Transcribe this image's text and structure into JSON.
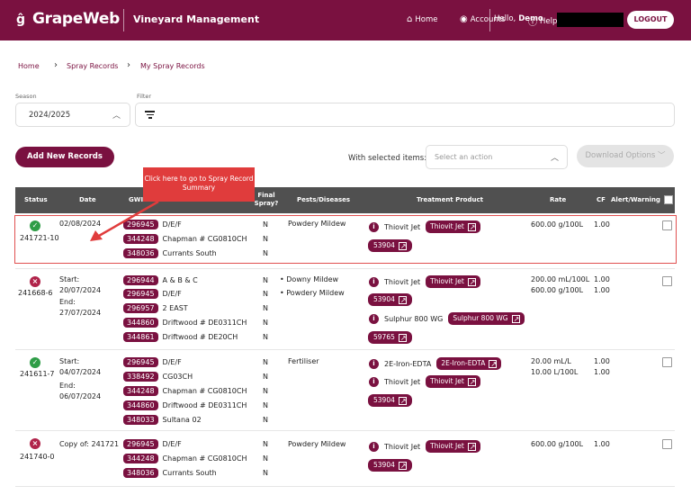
{
  "header": {
    "brand": "GrapeWeb",
    "app_title": "Vineyard Management",
    "nav": {
      "home": "Home",
      "accounts": "Accounts",
      "help": "Help"
    },
    "greeting_prefix": "Hello, ",
    "user_name": "Demo",
    "logout": "LOGOUT"
  },
  "breadcrumb": {
    "items": [
      "Home",
      "Spray Records",
      "My Spray Records"
    ]
  },
  "filters": {
    "season_label": "Season",
    "season_value": "2024/2025",
    "filter_label": "Filter"
  },
  "actions": {
    "add_label": "Add New Records",
    "with_selected": "With selected items:",
    "select_placeholder": "Select an action",
    "download": "Download Options"
  },
  "tooltip": {
    "text": "Click here to go to Spray Record Summary"
  },
  "table": {
    "headers": {
      "status": "Status",
      "date": "Date",
      "gwi": "GWI",
      "final_spray": "Final Spray?",
      "pests": "Pests/Diseases",
      "product": "Treatment Product",
      "rate": "Rate",
      "cf": "CF",
      "alert": "Alert/Warning"
    },
    "rows": [
      {
        "status": "ok",
        "id": "241721-10",
        "date_lines": [
          "02/08/2024"
        ],
        "gwi": [
          {
            "code": "296945",
            "name": "D/E/F",
            "final": "N"
          },
          {
            "code": "344248",
            "name": "Chapman # CG0810CH",
            "final": "N"
          },
          {
            "code": "348036",
            "name": "Currants South",
            "final": "N"
          }
        ],
        "pests": [
          "Powdery Mildew"
        ],
        "products": [
          {
            "name": "Thiovit Jet",
            "pill": "Thiovit Jet"
          }
        ],
        "codes": [
          "53904"
        ],
        "rates": [
          "600.00 g/100L"
        ],
        "cf": [
          "1.00"
        ]
      },
      {
        "status": "x",
        "id": "241668-6",
        "date_lines": [
          "Start:",
          "20/07/2024",
          "End:",
          "27/07/2024"
        ],
        "gwi": [
          {
            "code": "296944",
            "name": "A & B & C",
            "final": "N"
          },
          {
            "code": "296945",
            "name": "D/E/F",
            "final": "N"
          },
          {
            "code": "296957",
            "name": "2 EAST",
            "final": "N"
          },
          {
            "code": "344860",
            "name": "Driftwood # DE0311CH",
            "final": "N"
          },
          {
            "code": "344861",
            "name": "Driftwood # DE20CH",
            "final": "N"
          }
        ],
        "pests": [
          "Downy Mildew",
          "Powdery Mildew"
        ],
        "products": [
          {
            "name": "Thiovit Jet",
            "pill": "Thiovit Jet"
          },
          {
            "name": "Sulphur 800 WG",
            "pill": "Sulphur 800 WG"
          }
        ],
        "codes": [
          "53904",
          "59765"
        ],
        "rates": [
          "200.00 mL/100L",
          "600.00 g/100L"
        ],
        "cf": [
          "1.00",
          "1.00"
        ]
      },
      {
        "status": "ok",
        "id": "241611-7",
        "date_lines": [
          "Start:",
          "04/07/2024",
          "End:",
          "06/07/2024"
        ],
        "gwi": [
          {
            "code": "296945",
            "name": "D/E/F",
            "final": "N"
          },
          {
            "code": "338492",
            "name": "CG03CH",
            "final": "N"
          },
          {
            "code": "344248",
            "name": "Chapman # CG0810CH",
            "final": "N"
          },
          {
            "code": "344860",
            "name": "Driftwood # DE0311CH",
            "final": "N"
          },
          {
            "code": "348033",
            "name": "Sultana 02",
            "final": "N"
          }
        ],
        "pests": [
          "Fertiliser"
        ],
        "products": [
          {
            "name": "2E-Iron-EDTA",
            "pill": "2E-Iron-EDTA"
          },
          {
            "name": "Thiovit Jet",
            "pill": "Thiovit Jet"
          }
        ],
        "codes": [
          "53904"
        ],
        "rates": [
          "20.00 mL/L",
          "10.00 L/100L"
        ],
        "cf": [
          "1.00",
          "1.00"
        ]
      },
      {
        "status": "x",
        "id": "241740-0",
        "date_lines": [
          "Copy of: 241721"
        ],
        "gwi": [
          {
            "code": "296945",
            "name": "D/E/F",
            "final": "N"
          },
          {
            "code": "344248",
            "name": "Chapman # CG0810CH",
            "final": "N"
          },
          {
            "code": "348036",
            "name": "Currants South",
            "final": "N"
          }
        ],
        "pests": [
          "Powdery Mildew"
        ],
        "products": [
          {
            "name": "Thiovit Jet",
            "pill": "Thiovit Jet"
          }
        ],
        "codes": [
          "53904"
        ],
        "rates": [
          "600.00 g/100L"
        ],
        "cf": [
          "1.00"
        ]
      }
    ]
  },
  "colors": {
    "brand": "#7a1140",
    "ok": "#2f9d47",
    "error": "#b0234a",
    "annotation": "#e03c3c"
  }
}
